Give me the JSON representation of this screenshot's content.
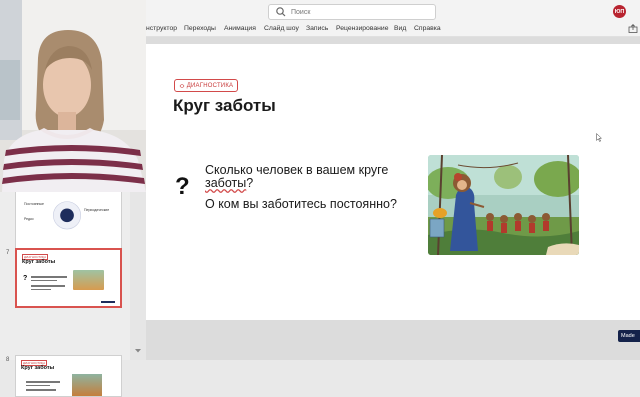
{
  "search": {
    "placeholder": "Поиск"
  },
  "user": {
    "initials": "ЮП"
  },
  "menu": [
    "нструктор",
    "Переходы",
    "Анимация",
    "Слайд шоу",
    "Запись",
    "Рецензирование",
    "Вид",
    "Справка"
  ],
  "slides_panel": {
    "slide6": {
      "title": "Зоны в кругу",
      "lines": [
        "Постоянные",
        "Периодические",
        "Редко"
      ]
    },
    "slide7": {
      "number": "7",
      "badge": "ДИАГНОСТИКА",
      "title": "Круг заботы",
      "q": "?"
    },
    "slide8": {
      "number": "8",
      "badge": "ДИАГНОСТИКА",
      "title": "Круг заботы"
    }
  },
  "slide": {
    "badge": "ДИАГНОСТИКА",
    "title": "Круг заботы",
    "question_mark": "?",
    "q1_part1": "Сколько человек в вашем круге ",
    "q1_underlined": "заботы",
    "q1_part2": "?",
    "q2": "О ком вы заботитесь постоянно?"
  },
  "watermark": {
    "label": "Made"
  },
  "colors": {
    "accent": "#d24a4a",
    "avatar": "#b8232f",
    "badge_dark": "#14224a"
  }
}
